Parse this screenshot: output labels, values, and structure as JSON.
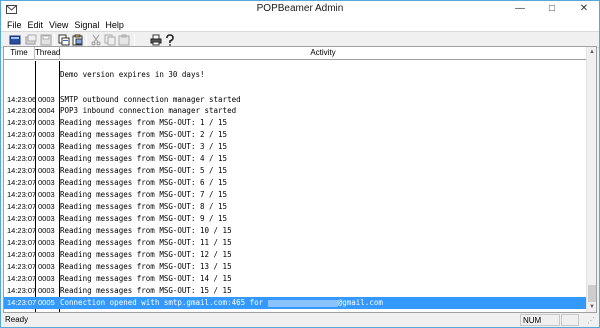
{
  "window": {
    "title": "POPBeamer Admin",
    "minimize_glyph": "—",
    "maximize_glyph": "□",
    "close_glyph": "✕"
  },
  "menu": {
    "items": [
      {
        "label": "File"
      },
      {
        "label": "Edit"
      },
      {
        "label": "View"
      },
      {
        "label": "Signal"
      },
      {
        "label": "Help"
      }
    ]
  },
  "toolbar": {
    "icons": [
      "new-icon",
      "open-icon",
      "save-icon",
      "copy-icon",
      "paste-icon",
      "cut-icon",
      "copy-doc-icon",
      "paste-doc-icon",
      "print-icon",
      "help-icon"
    ]
  },
  "log": {
    "headers": {
      "time": "Time",
      "thread": "Thread",
      "activity": "Activity"
    },
    "rows": [
      {
        "time": "",
        "thread": "",
        "activity": ""
      },
      {
        "time": "",
        "thread": "",
        "activity": "Demo version expires in 30 days!"
      },
      {
        "time": "",
        "thread": "",
        "activity": ""
      },
      {
        "time": "14:23:06",
        "thread": "0003",
        "activity": "SMTP outbound connection manager started"
      },
      {
        "time": "14:23:06",
        "thread": "0004",
        "activity": "POP3 inbound connection manager started"
      },
      {
        "time": "14:23:07",
        "thread": "0003",
        "activity": "Reading messages from MSG-OUT: 1 / 15"
      },
      {
        "time": "14:23:07",
        "thread": "0003",
        "activity": "Reading messages from MSG-OUT: 2 / 15"
      },
      {
        "time": "14:23:07",
        "thread": "0003",
        "activity": "Reading messages from MSG-OUT: 3 / 15"
      },
      {
        "time": "14:23:07",
        "thread": "0003",
        "activity": "Reading messages from MSG-OUT: 4 / 15"
      },
      {
        "time": "14:23:07",
        "thread": "0003",
        "activity": "Reading messages from MSG-OUT: 5 / 15"
      },
      {
        "time": "14:23:07",
        "thread": "0003",
        "activity": "Reading messages from MSG-OUT: 6 / 15"
      },
      {
        "time": "14:23:07",
        "thread": "0003",
        "activity": "Reading messages from MSG-OUT: 7 / 15"
      },
      {
        "time": "14:23:07",
        "thread": "0003",
        "activity": "Reading messages from MSG-OUT: 8 / 15"
      },
      {
        "time": "14:23:07",
        "thread": "0003",
        "activity": "Reading messages from MSG-OUT: 9 / 15"
      },
      {
        "time": "14:23:07",
        "thread": "0003",
        "activity": "Reading messages from MSG-OUT: 10 / 15"
      },
      {
        "time": "14:23:07",
        "thread": "0003",
        "activity": "Reading messages from MSG-OUT: 11 / 15"
      },
      {
        "time": "14:23:07",
        "thread": "0003",
        "activity": "Reading messages from MSG-OUT: 12 / 15"
      },
      {
        "time": "14:23:07",
        "thread": "0003",
        "activity": "Reading messages from MSG-OUT: 13 / 15"
      },
      {
        "time": "14:23:07",
        "thread": "0003",
        "activity": "Reading messages from MSG-OUT: 14 / 15"
      },
      {
        "time": "14:23:07",
        "thread": "0003",
        "activity": "Reading messages from MSG-OUT: 15 / 15"
      }
    ],
    "selected_row": {
      "time": "14:23:07",
      "thread": "0005",
      "activity_prefix": "Connection opened with smtp.gmail.com:465 for",
      "activity_suffix": "@gmail.com"
    }
  },
  "statusbar": {
    "status": "Ready",
    "num": "NUM"
  },
  "colors": {
    "selection": "#3399ff",
    "window_border": "#58a8d6"
  }
}
